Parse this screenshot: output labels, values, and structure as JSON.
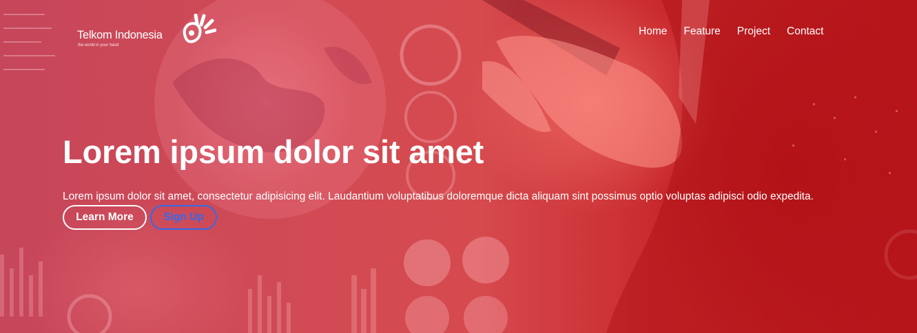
{
  "brand": {
    "name": "Telkom Indonesia",
    "tagline": "the world in your hand"
  },
  "nav": {
    "items": [
      "Home",
      "Feature",
      "Project",
      "Contact"
    ]
  },
  "hero": {
    "headline": "Lorem ipsum dolor sit amet",
    "lead": "Lorem ipsum dolor sit amet, consectetur adipisicing elit. Laudantium voluptatibus doloremque dicta aliquam sint possimus optio voluptas adipisci odio expedita.",
    "primary_button": "Learn More",
    "secondary_button": "Sign Up"
  },
  "colors": {
    "overlay": "#d04a55",
    "text": "#ffffff",
    "signup_accent": "#2f6bf0"
  },
  "icons": {
    "logo_mark": "telkom-hand-icon"
  }
}
